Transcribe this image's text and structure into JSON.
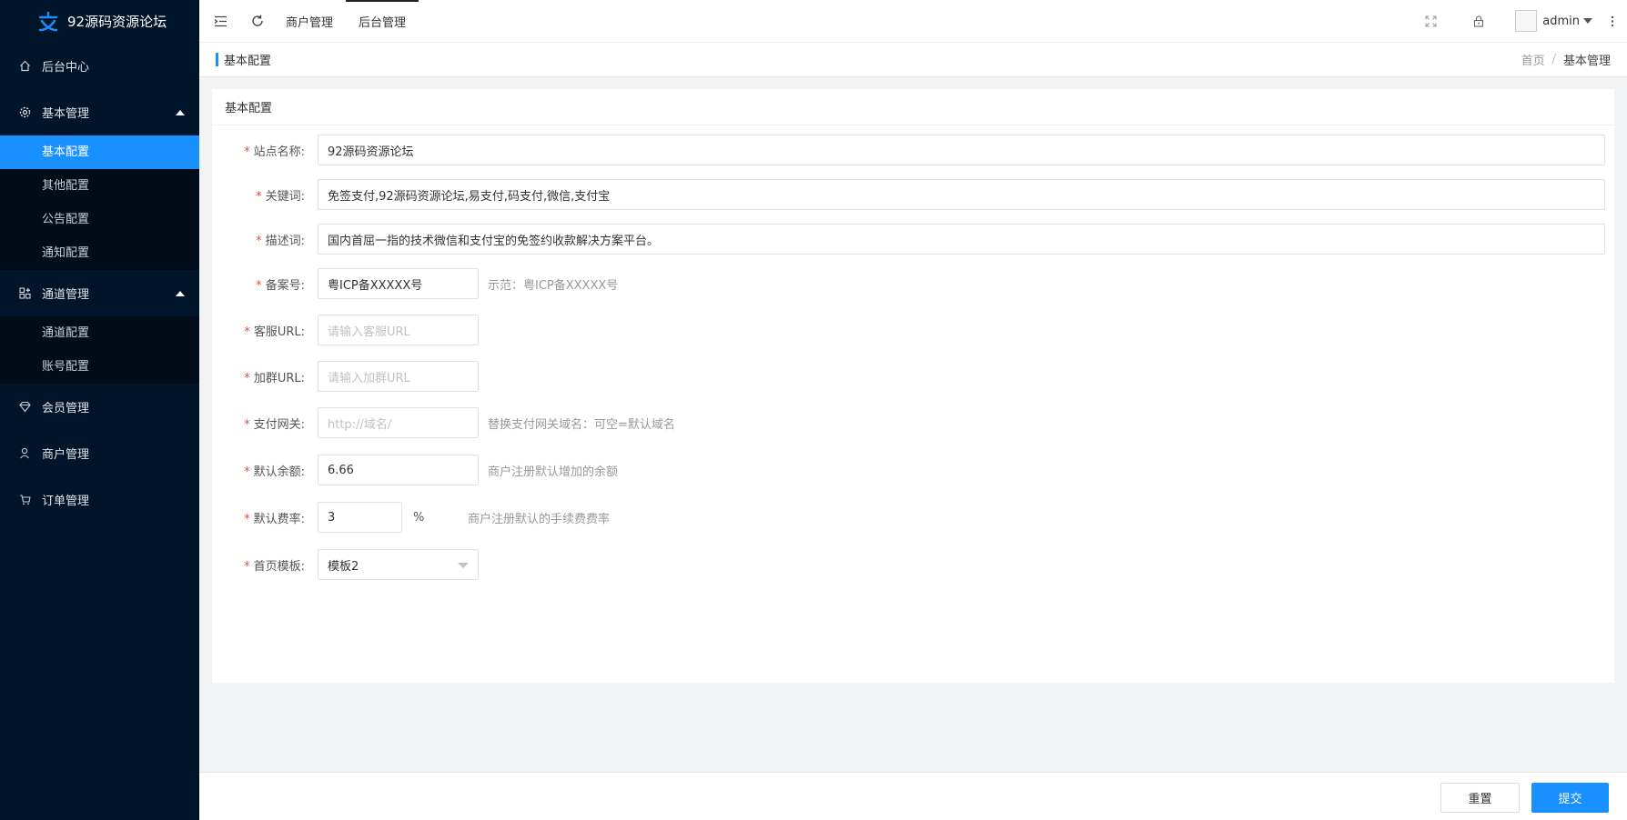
{
  "app": {
    "title": "92源码资源论坛"
  },
  "sidebar": {
    "home": "后台中心",
    "groups": [
      {
        "label": "基本管理",
        "items": [
          "基本配置",
          "其他配置",
          "公告配置",
          "通知配置"
        ]
      },
      {
        "label": "通道管理",
        "items": [
          "通道配置",
          "账号配置"
        ]
      }
    ],
    "member": "会员管理",
    "merchant": "商户管理",
    "order": "订单管理"
  },
  "header": {
    "tabs": [
      "商户管理",
      "后台管理"
    ],
    "user": "admin"
  },
  "breadcrumb": {
    "title": "基本配置",
    "home": "首页",
    "sep": "/",
    "current": "基本管理"
  },
  "card": {
    "title": "基本配置"
  },
  "form": {
    "site_name": {
      "label": "站点名称:",
      "value": "92源码资源论坛"
    },
    "keywords": {
      "label": "关键词:",
      "value": "免签支付,92源码资源论坛,易支付,码支付,微信,支付宝"
    },
    "description": {
      "label": "描述词:",
      "value": "国内首屈一指的技术微信和支付宝的免签约收款解决方案平台。"
    },
    "icp": {
      "label": "备案号:",
      "value": "粤ICP备XXXXX号",
      "tip": "示范：粤ICP备XXXXX号"
    },
    "service_url": {
      "label": "客服URL:",
      "placeholder": "请输入客服URL"
    },
    "group_url": {
      "label": "加群URL:",
      "placeholder": "请输入加群URL"
    },
    "gateway": {
      "label": "支付网关:",
      "placeholder": "http://域名/",
      "tip": "替换支付网关域名：可空=默认域名"
    },
    "balance": {
      "label": "默认余额:",
      "value": "6.66",
      "tip": "商户注册默认增加的余额"
    },
    "rate": {
      "label": "默认费率:",
      "value": "3",
      "unit": "%",
      "tip": "商户注册默认的手续费费率"
    },
    "template": {
      "label": "首页模板:",
      "value": "模板2"
    }
  },
  "buttons": {
    "reset": "重置",
    "submit": "提交"
  },
  "colors": {
    "sidebar_bg": "#001529",
    "accent": "#1890ff",
    "required": "#e24c4c"
  }
}
